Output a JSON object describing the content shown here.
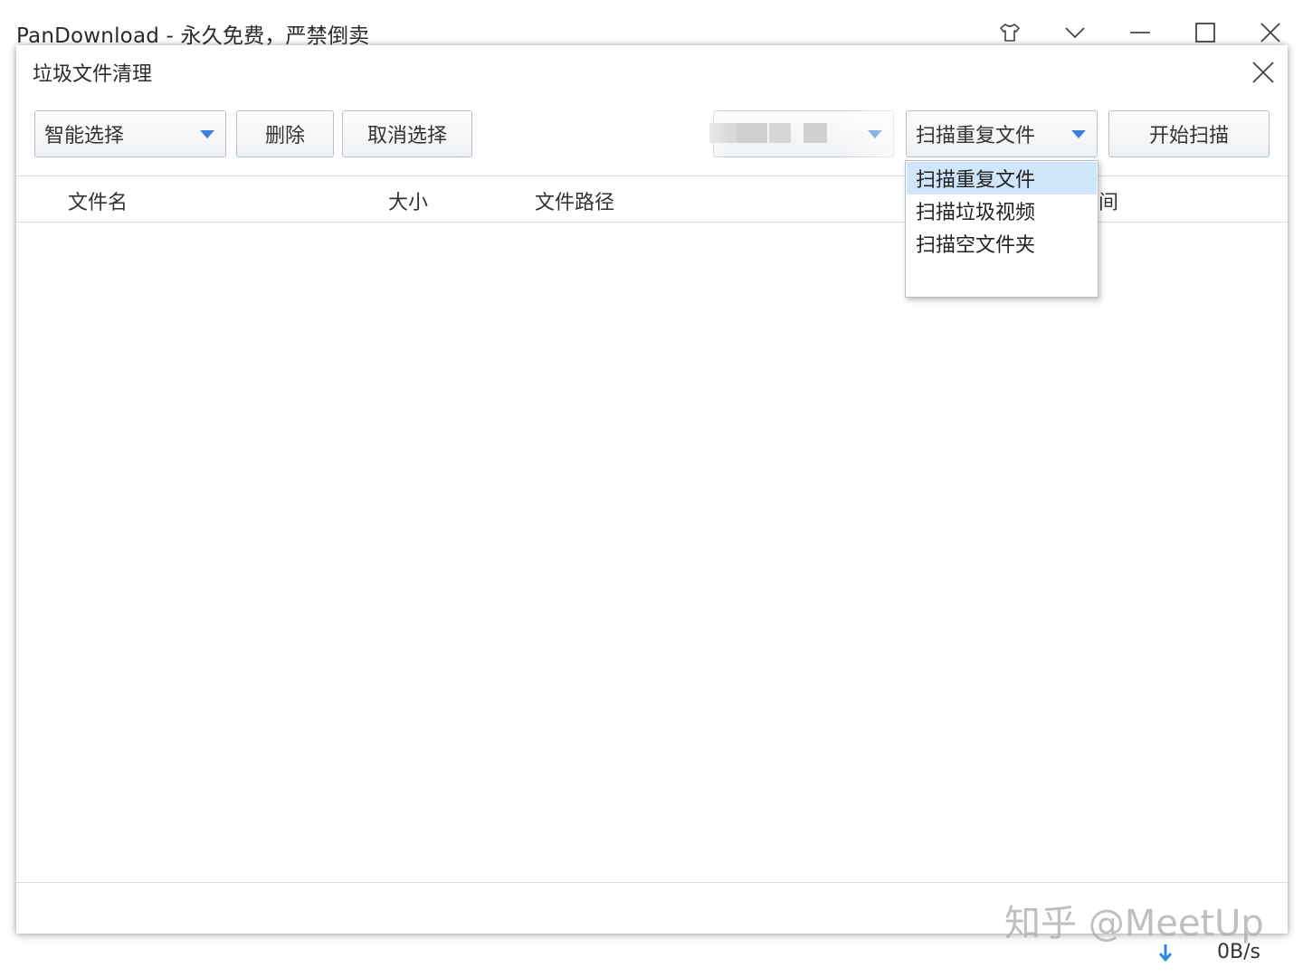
{
  "app": {
    "title": "PanDownload - 永久免费，严禁倒卖",
    "controls": [
      "skin-icon",
      "menu-chevron-icon",
      "minimize-icon",
      "maximize-icon",
      "close-icon"
    ]
  },
  "dialog": {
    "title": "垃圾文件清理",
    "toolbar": {
      "smart_select": "智能选择",
      "delete": "删除",
      "cancel_select": "取消选择",
      "scan_type": "扫描重复文件",
      "start_scan": "开始扫描"
    },
    "columns": [
      "文件名",
      "大小",
      "文件路径",
      "间"
    ],
    "dropdown_options": [
      "扫描重复文件",
      "扫描垃圾视频",
      "扫描空文件夹"
    ],
    "selected_option": "扫描重复文件"
  },
  "watermark": "知乎 @MeetUp",
  "status": {
    "download_icon": "download-arrow-icon",
    "speed": "0B/s"
  },
  "colors": {
    "accent": "#3b82d8",
    "selection": "#cfe6fb"
  }
}
